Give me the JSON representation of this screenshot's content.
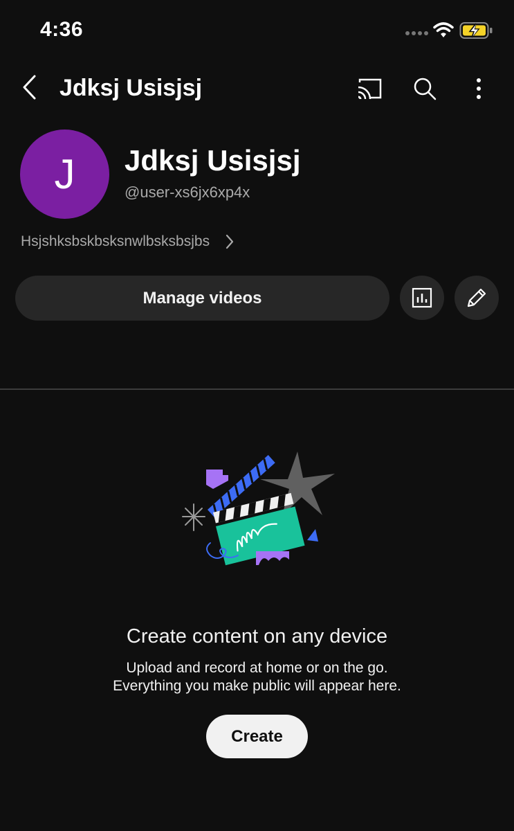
{
  "status_bar": {
    "time": "4:36"
  },
  "header": {
    "title": "Jdksj Usisjsj",
    "icons": [
      "back-icon",
      "cast-icon",
      "search-icon",
      "more-vert-icon"
    ]
  },
  "channel": {
    "avatar_letter": "J",
    "avatar_color": "#7b1fa2",
    "name": "Jdksj Usisjsj",
    "handle": "@user-xs6jx6xp4x",
    "description": "Hsjshksbskbsksnwlbsksbsjbs"
  },
  "actions": {
    "manage_label": "Manage videos",
    "icons": [
      "analytics-icon",
      "edit-icon"
    ]
  },
  "empty_state": {
    "title": "Create content on any device",
    "line1": "Upload and record at home or on the go.",
    "line2": "Everything you make public will appear here.",
    "create_label": "Create"
  },
  "colors": {
    "background": "#0f0f0f",
    "button_bg": "#272727",
    "accent_green": "#19c29b",
    "accent_blue": "#3d6cf5",
    "accent_purple": "#a673f5",
    "battery_yellow": "#f5d328"
  }
}
